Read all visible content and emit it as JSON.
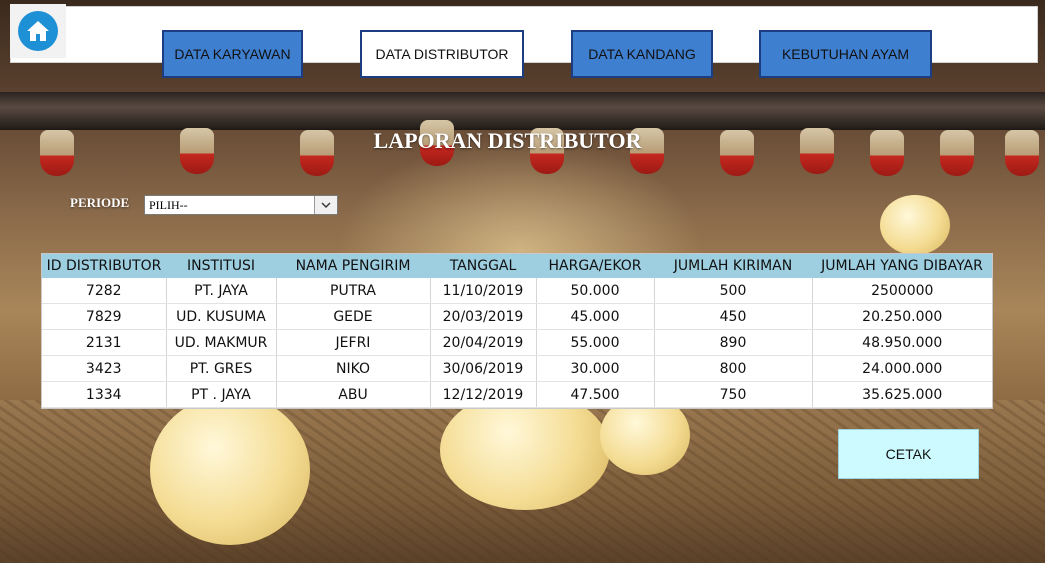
{
  "nav": {
    "home_icon": "home-icon",
    "tabs": [
      {
        "label": "DATA KARYAWAN",
        "active": false
      },
      {
        "label": "DATA DISTRIBUTOR",
        "active": true
      },
      {
        "label": "DATA KANDANG",
        "active": false
      },
      {
        "label": "KEBUTUHAN AYAM",
        "active": false
      }
    ]
  },
  "title": "LAPORAN DISTRIBUTOR",
  "periode": {
    "label": "PERIODE",
    "selected": "PILIH--"
  },
  "table": {
    "headers": [
      "ID DISTRIBUTOR",
      "INSTITUSI",
      "NAMA PENGIRIM",
      "TANGGAL",
      "HARGA/EKOR",
      "JUMLAH KIRIMAN",
      "JUMLAH YANG DIBAYAR"
    ],
    "rows": [
      [
        "7282",
        "PT. JAYA",
        "PUTRA",
        "11/10/2019",
        "50.000",
        "500",
        "2500000"
      ],
      [
        "7829",
        "UD. KUSUMA",
        "GEDE",
        "20/03/2019",
        "45.000",
        "450",
        "20.250.000"
      ],
      [
        "2131",
        "UD. MAKMUR",
        "JEFRI",
        "20/04/2019",
        "55.000",
        "890",
        "48.950.000"
      ],
      [
        "3423",
        "PT. GRES",
        "NIKO",
        "30/06/2019",
        "30.000",
        "800",
        "24.000.000"
      ],
      [
        "1334",
        "PT . JAYA",
        "ABU",
        "12/12/2019",
        "47.500",
        "750",
        "35.625.000"
      ]
    ]
  },
  "print_button": "CETAK",
  "colors": {
    "nav_active_bg": "#ffffff",
    "nav_inactive_bg": "#3f7fd0",
    "nav_border": "#1d3d82",
    "table_header_bg": "#9dcfe0",
    "print_button_bg": "#ccfaff",
    "home_icon_bg": "#1e90d6"
  }
}
